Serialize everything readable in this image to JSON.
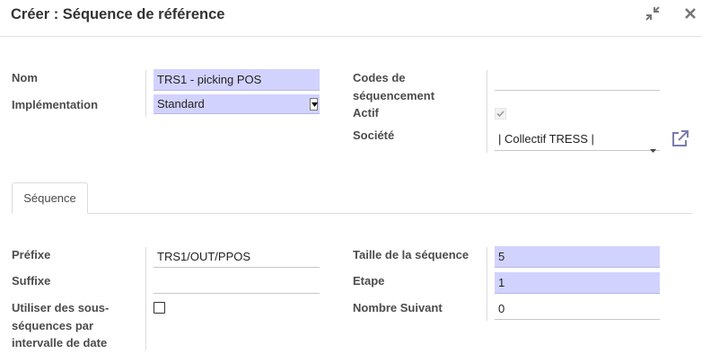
{
  "dialog": {
    "title": "Créer : Séquence de référence",
    "minimize_icon": "compress-icon",
    "close_icon": "close-icon"
  },
  "form": {
    "nom": {
      "label": "Nom",
      "value": "TRS1 - picking POS"
    },
    "implementation": {
      "label": "Implémentation",
      "value": "Standard"
    },
    "codes": {
      "label_line1": "Codes de",
      "label_line2": "séquencement",
      "value": ""
    },
    "actif": {
      "label": "Actif",
      "checked": true
    },
    "societe": {
      "label": "Société",
      "value": "| Collectif TRESS |",
      "link_icon": "external-link-icon"
    }
  },
  "tabs": [
    {
      "label": "Séquence",
      "active": true
    }
  ],
  "sequence": {
    "prefixe": {
      "label": "Préfixe",
      "value": "TRS1/OUT/PPOS"
    },
    "suffixe": {
      "label": "Suffixe",
      "value": ""
    },
    "sous_seq": {
      "label_line1": "Utiliser des sous-",
      "label_line2": "séquences par",
      "label_line3": "intervalle de date",
      "checked": false
    },
    "taille": {
      "label": "Taille de la séquence",
      "value": "5"
    },
    "etape": {
      "label": "Etape",
      "value": "1"
    },
    "suivant": {
      "label": "Nombre Suivant",
      "value": "0"
    }
  },
  "colors": {
    "required_bg": "#d2d2ff",
    "link_icon": "#7c7bad"
  }
}
